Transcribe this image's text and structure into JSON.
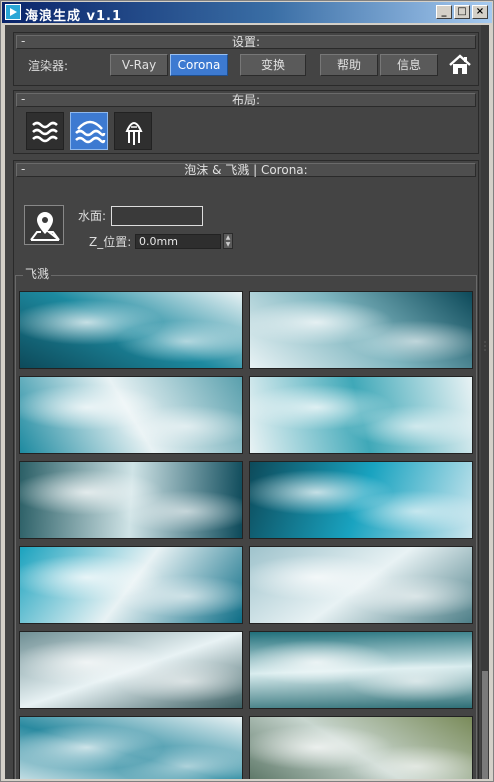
{
  "window": {
    "title": "海浪生成 v1.1",
    "controls": {
      "minimize": "_",
      "maximize": "□",
      "close": "×"
    }
  },
  "settings": {
    "title": "设置:",
    "collapse": "-",
    "renderer_label": "渲染器:",
    "buttons": [
      "V-Ray",
      "Corona",
      "变换",
      "帮助",
      "信息"
    ],
    "active_renderer": "Corona",
    "home_icon": "home-icon"
  },
  "layout": {
    "title": "布局:",
    "collapse": "-",
    "icons": [
      "waves-icon",
      "waves-selected-icon",
      "jellyfish-icon"
    ],
    "selected_index": 1
  },
  "foam": {
    "title": "泡沫 & 飞溅 | Corona:",
    "collapse": "-",
    "pick_icon": "map-pin-icon",
    "surface_label": "水面:",
    "surface_value": "",
    "z_label": "Z_位置:",
    "z_value": "0.0mm",
    "spinner_up": "▲",
    "spinner_down": "▼",
    "group_label": "飞溅",
    "thumbnail_icon": "foam-texture-thumbnail",
    "thumbnail_count": 12
  },
  "colors": {
    "accent": "#3d7ad1",
    "panel_bg": "#444444",
    "title_bar_start": "#0a246a",
    "title_bar_end": "#a6caf0",
    "foam_light": "#e8f2f4",
    "water_teal": "#1d8aa0",
    "water_deep": "#0d4a5a"
  }
}
